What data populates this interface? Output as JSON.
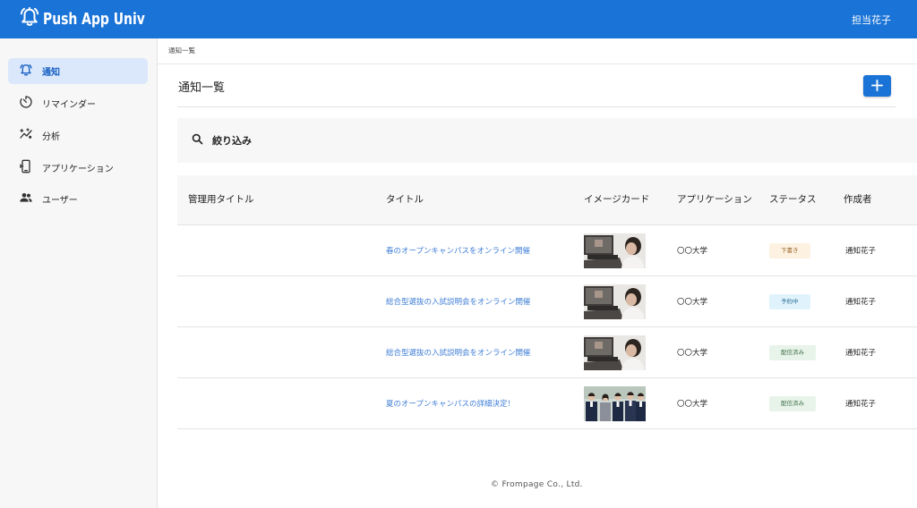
{
  "header": {
    "app_name": "Push App Univ",
    "user_name": "担当花子",
    "brand_color": "#1a73d6"
  },
  "sidebar": {
    "items": [
      {
        "label": "通知",
        "icon": "bell-icon",
        "active": true
      },
      {
        "label": "リマインダー",
        "icon": "timer-icon",
        "active": false
      },
      {
        "label": "分析",
        "icon": "analytics-icon",
        "active": false
      },
      {
        "label": "アプリケーション",
        "icon": "phone-app-icon",
        "active": false
      },
      {
        "label": "ユーザー",
        "icon": "users-icon",
        "active": false
      }
    ]
  },
  "main": {
    "breadcrumb": "通知一覧",
    "page_title": "通知一覧",
    "add_button_icon": "plus-icon",
    "filter": {
      "label": "絞り込み",
      "icon": "search-icon"
    }
  },
  "table": {
    "columns": [
      "管理用タイトル",
      "タイトル",
      "イメージカード",
      "アプリケーション",
      "ステータス",
      "作成者"
    ],
    "rows": [
      {
        "admin_title": "",
        "title": "春のオープンキャンパスをオンライン開催",
        "image": "online-class-photo",
        "application": "〇〇大学",
        "status": "下書き",
        "status_color": "#fdf1e1",
        "author": "通知花子"
      },
      {
        "admin_title": "",
        "title": "総合型選抜の入試説明会をオンライン開催",
        "image": "online-class-photo",
        "application": "〇〇大学",
        "status": "予約中",
        "status_color": "#e0f3fc",
        "author": "通知花子"
      },
      {
        "admin_title": "",
        "title": "総合型選抜の入試説明会をオンライン開催",
        "image": "online-class-photo",
        "application": "〇〇大学",
        "status": "配信済み",
        "status_color": "#e8f3ea",
        "author": "通知花子"
      },
      {
        "admin_title": "",
        "title": "夏のオープンキャンパスの詳細決定！",
        "image": "students-group-photo",
        "application": "〇〇大学",
        "status": "配信済み",
        "status_color": "#e8f3ea",
        "author": "通知花子"
      }
    ]
  },
  "footer": {
    "copyright": "© Frompage Co., Ltd."
  }
}
